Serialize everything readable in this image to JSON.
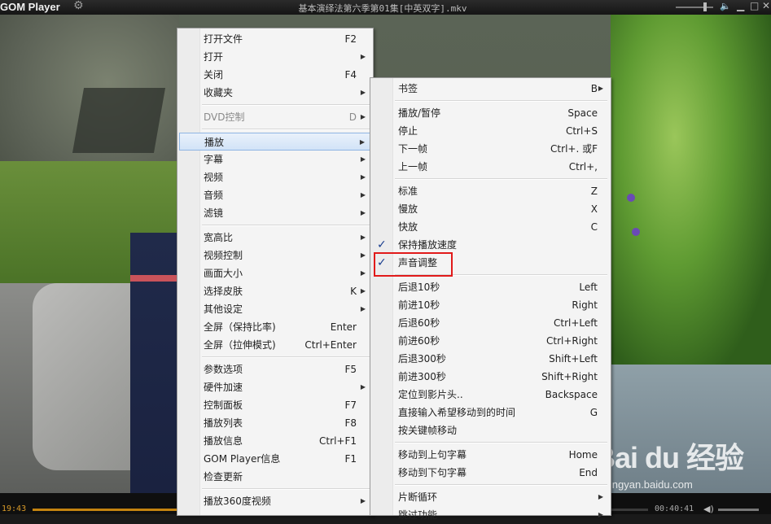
{
  "titlebar": {
    "app_name": "GOM Player",
    "title": "基本演绎法第六季第01集[中英双字].mkv"
  },
  "player": {
    "current_time": "19:43",
    "total_time": "00:40:41",
    "progress": 0.48
  },
  "menu_main": [
    {
      "label": "打开文件",
      "shortcut": "F2"
    },
    {
      "label": "打开",
      "submenu": true
    },
    {
      "label": "关闭",
      "shortcut": "F4"
    },
    {
      "label": "收藏夹",
      "submenu": true
    },
    {
      "sep": true
    },
    {
      "label": "DVD控制",
      "shortcut": "D",
      "submenu": true,
      "disabled": true
    },
    {
      "sep": true
    },
    {
      "label": "播放",
      "submenu": true,
      "highlight": true
    },
    {
      "label": "字幕",
      "submenu": true
    },
    {
      "label": "视频",
      "submenu": true
    },
    {
      "label": "音频",
      "submenu": true
    },
    {
      "label": "滤镜",
      "submenu": true
    },
    {
      "sep": true
    },
    {
      "label": "宽高比",
      "submenu": true
    },
    {
      "label": "视频控制",
      "submenu": true
    },
    {
      "label": "画面大小",
      "submenu": true
    },
    {
      "label": "选择皮肤",
      "shortcut": "K",
      "submenu": true
    },
    {
      "label": "其他设定",
      "submenu": true
    },
    {
      "label": "全屏（保持比率)",
      "shortcut": "Enter"
    },
    {
      "label": "全屏（拉伸模式)",
      "shortcut": "Ctrl+Enter"
    },
    {
      "sep": true
    },
    {
      "label": "参数选项",
      "shortcut": "F5"
    },
    {
      "label": "硬件加速",
      "submenu": true
    },
    {
      "label": "控制面板",
      "shortcut": "F7"
    },
    {
      "label": "播放列表",
      "shortcut": "F8"
    },
    {
      "label": "播放信息",
      "shortcut": "Ctrl+F1"
    },
    {
      "label": "GOM Player信息",
      "shortcut": "F1"
    },
    {
      "label": "检查更新"
    },
    {
      "sep": true
    },
    {
      "label": "播放360度视频",
      "submenu": true
    }
  ],
  "menu_play": [
    {
      "label": "书签",
      "shortcut": "B",
      "submenu": true
    },
    {
      "sep": true
    },
    {
      "label": "播放/暂停",
      "shortcut": "Space"
    },
    {
      "label": "停止",
      "shortcut": "Ctrl+S"
    },
    {
      "label": "下一帧",
      "shortcut": "Ctrl+. 或F"
    },
    {
      "label": "上一帧",
      "shortcut": "Ctrl+,"
    },
    {
      "sep": true
    },
    {
      "label": "标准",
      "shortcut": "Z"
    },
    {
      "label": "慢放",
      "shortcut": "X"
    },
    {
      "label": "快放",
      "shortcut": "C"
    },
    {
      "label": "保持播放速度",
      "checked": true
    },
    {
      "label": "声音调整",
      "checked": true
    },
    {
      "sep": true
    },
    {
      "label": "后退10秒",
      "shortcut": "Left"
    },
    {
      "label": "前进10秒",
      "shortcut": "Right"
    },
    {
      "label": "后退60秒",
      "shortcut": "Ctrl+Left"
    },
    {
      "label": "前进60秒",
      "shortcut": "Ctrl+Right"
    },
    {
      "label": "后退300秒",
      "shortcut": "Shift+Left"
    },
    {
      "label": "前进300秒",
      "shortcut": "Shift+Right"
    },
    {
      "label": "定位到影片头..",
      "shortcut": "Backspace"
    },
    {
      "label": "直接输入希望移动到的时间",
      "shortcut": "G"
    },
    {
      "label": "按关键帧移动"
    },
    {
      "sep": true
    },
    {
      "label": "移动到上句字幕",
      "shortcut": "Home"
    },
    {
      "label": "移动到下句字幕",
      "shortcut": "End"
    },
    {
      "sep": true
    },
    {
      "label": "片断循环",
      "submenu": true
    },
    {
      "label": "跳过功能",
      "submenu": true
    }
  ],
  "watermark": {
    "logo": "Bai du 经验",
    "url": "jingyan.baidu.com"
  },
  "icons": {
    "check": "checkmark-icon",
    "submenu": "submenu-arrow-icon"
  }
}
